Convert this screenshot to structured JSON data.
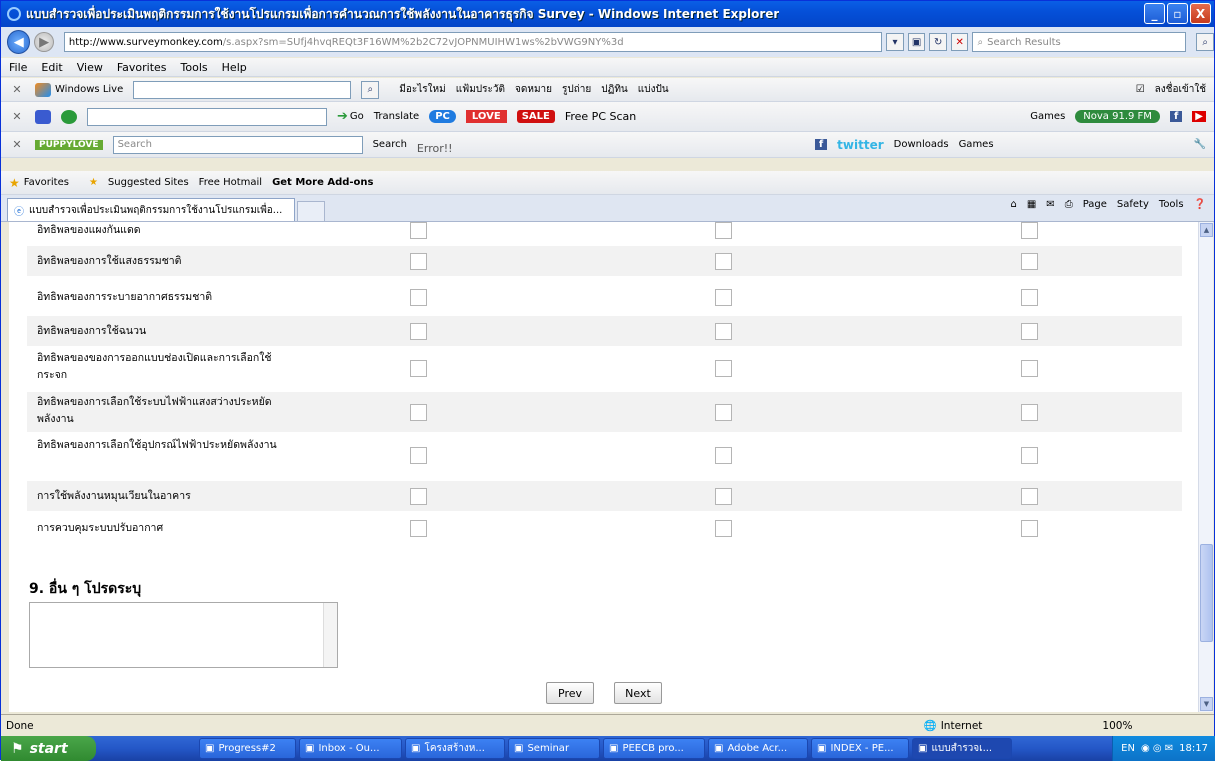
{
  "window": {
    "title": "แบบสำรวจเพื่อประเมินพฤติกรรมการใช้งานโปรแกรมเพื่อการคำนวณการใช้พลังงานในอาคารธุรกิจ Survey - Windows Internet Explorer",
    "min": "_",
    "max": "▫",
    "close": "X"
  },
  "address": {
    "url_host": "http://www.surveymonkey.com",
    "url_path": "/s.aspx?sm=SUfj4hvqREQt3F16WM%2b2C72vJOPNMUIHW1ws%2bVWG9NY%3d",
    "search_placeholder": "Search Results"
  },
  "menu": [
    "File",
    "Edit",
    "View",
    "Favorites",
    "Tools",
    "Help"
  ],
  "toolbar_live": {
    "brand": "Windows Live",
    "links": [
      "มีอะไรใหม่",
      "แฟ้มประวัติ",
      "จดหมาย",
      "รูปถ่าย",
      "ปฏิทิน",
      "แบ่งปัน"
    ],
    "signin": "ลงชื่อเข้าใช้"
  },
  "toolbar_translate": {
    "go": "Go",
    "translate": "Translate",
    "pc": "PC",
    "love": "LOVE",
    "sale": "SALE",
    "freepc": "Free PC Scan",
    "games": "Games",
    "radio": "Nova 91.9 FM"
  },
  "toolbar_search": {
    "logo": "PUPPYLOVE",
    "placeholder": "Search",
    "search_btn": "Search",
    "error": "Error!!",
    "twitter": "twitter",
    "downloads": "Downloads",
    "games": "Games"
  },
  "favorites": {
    "label": "Favorites",
    "items": [
      "Suggested Sites",
      "Free Hotmail",
      "Get More Add-ons"
    ]
  },
  "tab": {
    "label": "แบบสำรวจเพื่อประเมินพฤติกรรมการใช้งานโปรแกรมเพื่อ...",
    "commands": [
      "Page",
      "Safety",
      "Tools"
    ]
  },
  "survey": {
    "rows": [
      {
        "label": "อิทธิพลของแผงกันแดด"
      },
      {
        "label": "อิทธิพลของการใช้แสงธรรมชาติ"
      },
      {
        "label": "อิทธิพลของการระบายอากาศธรรมชาติ"
      },
      {
        "label": "อิทธิพลของการใช้ฉนวน"
      },
      {
        "label": "อิทธิพลของของการออกแบบช่องเปิดและการเลือกใช้กระจก"
      },
      {
        "label": "อิทธิพลของการเลือกใช้ระบบไฟฟ้าแสงสว่างประหยัดพลังงาน"
      },
      {
        "label": "อิทธิพลของการเลือกใช้อุปกรณ์ไฟฟ้าประหยัดพลังงาน"
      },
      {
        "label": "การใช้พลังงานหมุนเวียนในอาคาร"
      },
      {
        "label": "การควบคุมระบบปรับอากาศ"
      }
    ],
    "question9": "9. อื่น ๆ โปรดระบุ",
    "prev": "Prev",
    "next": "Next"
  },
  "status": {
    "left": "Done",
    "zone": "Internet",
    "zoom": "100%"
  },
  "taskbar": {
    "start": "start",
    "items": [
      "Progress#2",
      "Inbox - Ou...",
      "โครงสร้างห...",
      "Seminar",
      "PEECB pro...",
      "Adobe Acr...",
      "INDEX - PE...",
      "แบบสำรวจเ..."
    ],
    "lang": "EN",
    "clock": "18:17"
  },
  "colors": {
    "titlebar": "#0550d8",
    "taskbar": "#2457c7",
    "start": "#308a30"
  }
}
